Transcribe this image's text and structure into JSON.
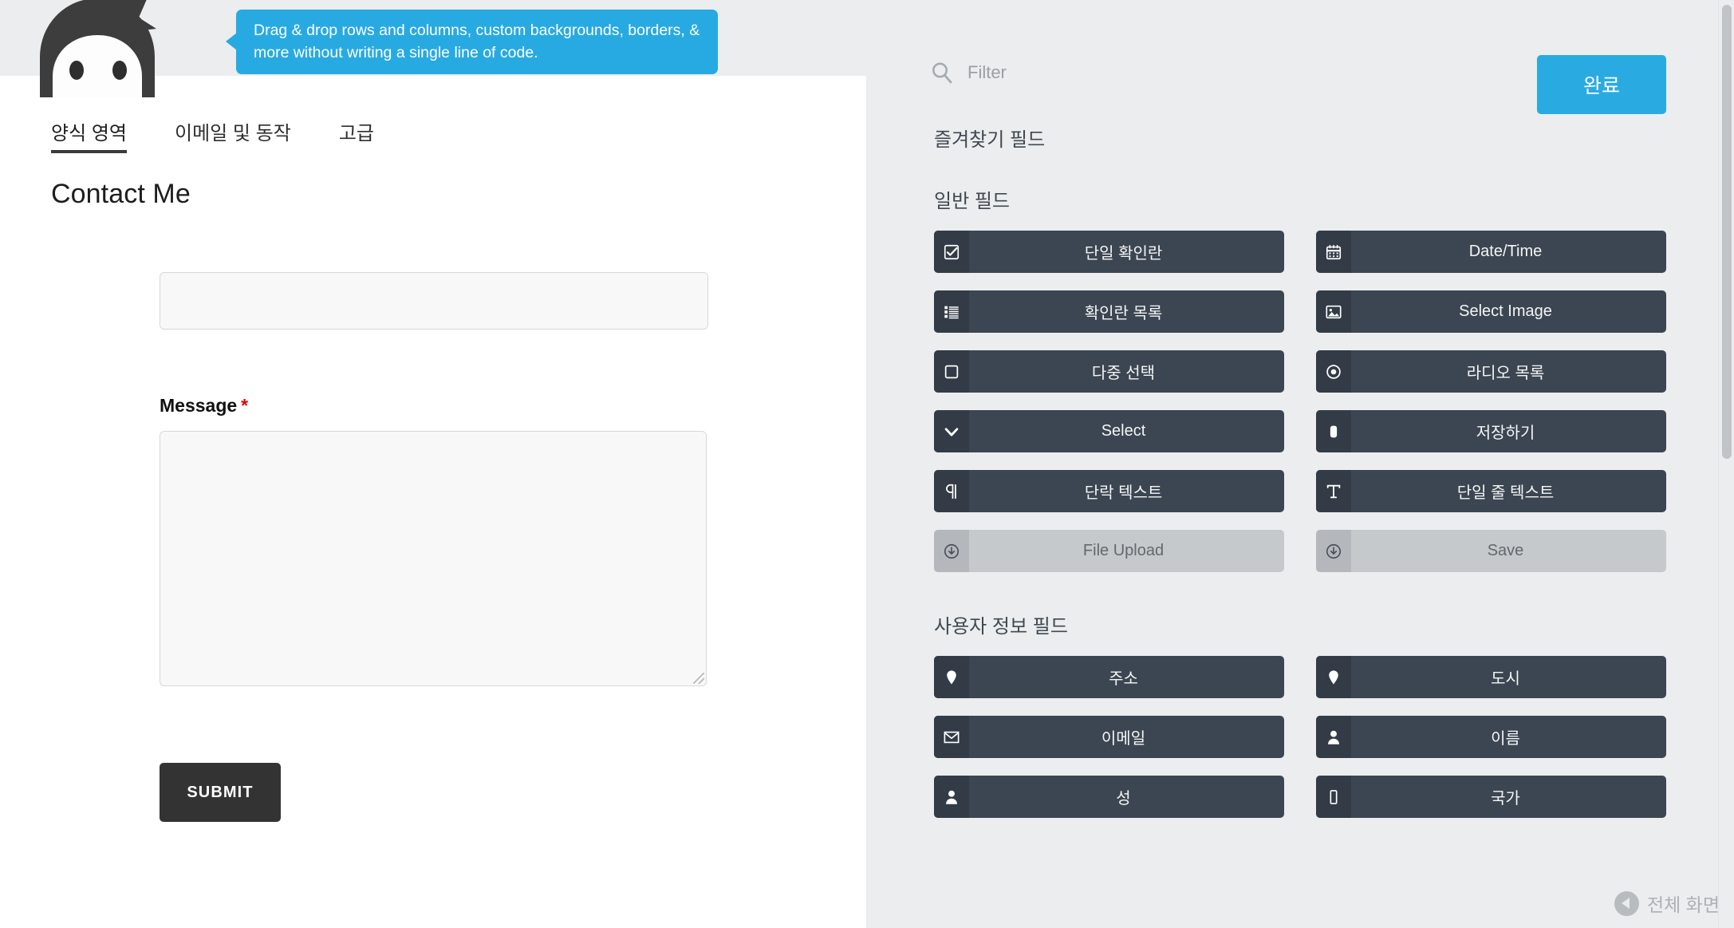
{
  "tooltip": {
    "text": "Drag & drop rows and columns, custom backgrounds, borders, & more without writing a single line of code."
  },
  "logo": {
    "name": "ninja-logo"
  },
  "preview": {
    "tabs": [
      {
        "label": "양식 영역",
        "active": true
      },
      {
        "label": "이메일 및 동작",
        "active": false
      },
      {
        "label": "고급",
        "active": false
      }
    ],
    "title": "Contact Me",
    "fields": {
      "name": {
        "value": "",
        "placeholder": ""
      },
      "message_label": "Message",
      "required_mark": "*",
      "message": {
        "value": "",
        "placeholder": ""
      }
    },
    "submit_label": "SUBMIT"
  },
  "palette": {
    "filter": {
      "value": "",
      "placeholder": "Filter"
    },
    "done_label": "완료",
    "sections": [
      {
        "heading": "즐겨찾기 필드",
        "items": []
      },
      {
        "heading": "일반 필드",
        "items": [
          {
            "label": "단일 확인란",
            "icon": "checkbox-checked-icon",
            "disabled": false
          },
          {
            "label": "Date/Time",
            "icon": "calendar-icon",
            "disabled": false
          },
          {
            "label": "확인란 목록",
            "icon": "list-icon",
            "disabled": false
          },
          {
            "label": "Select Image",
            "icon": "image-icon",
            "disabled": false
          },
          {
            "label": "다중 선택",
            "icon": "square-icon",
            "disabled": false
          },
          {
            "label": "라디오 목록",
            "icon": "radio-icon",
            "disabled": false
          },
          {
            "label": "Select",
            "icon": "chevron-down-icon",
            "disabled": false
          },
          {
            "label": "저장하기",
            "icon": "rounded-square-icon",
            "disabled": false
          },
          {
            "label": "단락 텍스트",
            "icon": "paragraph-icon",
            "disabled": false
          },
          {
            "label": "단일 줄 텍스트",
            "icon": "text-cursor-icon",
            "disabled": false
          },
          {
            "label": "File Upload",
            "icon": "download-circle-icon",
            "disabled": true
          },
          {
            "label": "Save",
            "icon": "download-circle-icon",
            "disabled": true
          }
        ]
      },
      {
        "heading": "사용자 정보 필드",
        "items": [
          {
            "label": "주소",
            "icon": "map-pin-icon",
            "disabled": false
          },
          {
            "label": "도시",
            "icon": "map-pin-icon",
            "disabled": false
          },
          {
            "label": "이메일",
            "icon": "envelope-icon",
            "disabled": false
          },
          {
            "label": "이름",
            "icon": "user-icon",
            "disabled": false
          },
          {
            "label": "성",
            "icon": "user-icon",
            "disabled": false
          },
          {
            "label": "국가",
            "icon": "rect-icon",
            "disabled": false
          }
        ]
      }
    ]
  },
  "watermark": {
    "text": "전체 화면"
  },
  "colors": {
    "accent": "#29abe2",
    "chip_bg": "#3c4652",
    "chip_icon_bg": "#333b46",
    "chip_disabled_bg": "#c6c9cc",
    "panel_bg": "#ebedee",
    "preview_bg": "#ffffff",
    "submit_bg": "#333333",
    "required": "#e50000"
  }
}
